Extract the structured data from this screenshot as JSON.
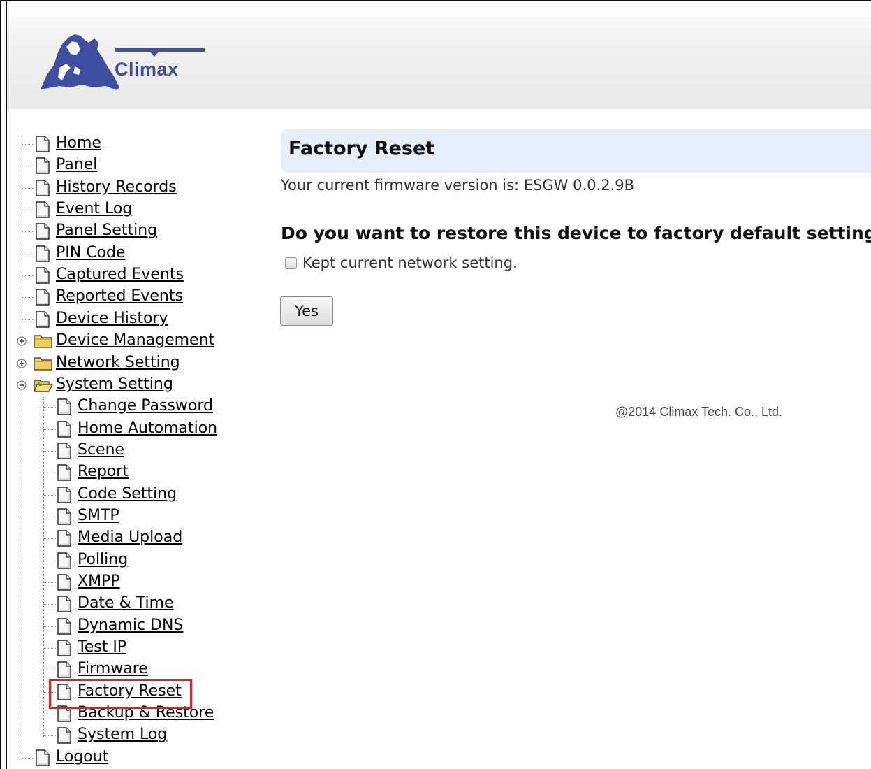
{
  "brand": {
    "name": "Climax",
    "primary_color": "#3e4ea0"
  },
  "nav": {
    "items": [
      {
        "label": "Home",
        "icon": "document-icon"
      },
      {
        "label": "Panel",
        "icon": "document-icon"
      },
      {
        "label": "History Records",
        "icon": "document-icon"
      },
      {
        "label": "Event Log",
        "icon": "document-icon"
      },
      {
        "label": "Panel Setting",
        "icon": "document-icon"
      },
      {
        "label": "PIN Code",
        "icon": "document-icon"
      },
      {
        "label": "Captured Events",
        "icon": "document-icon"
      },
      {
        "label": "Reported Events",
        "icon": "document-icon"
      },
      {
        "label": "Device History",
        "icon": "document-icon"
      },
      {
        "label": "Device Management",
        "icon": "folder-icon",
        "expandable": true,
        "expanded": false
      },
      {
        "label": "Network Setting",
        "icon": "folder-icon",
        "expandable": true,
        "expanded": false
      },
      {
        "label": "System Setting",
        "icon": "folder-open-icon",
        "expandable": true,
        "expanded": true
      }
    ],
    "system_children": [
      {
        "label": "Change Password"
      },
      {
        "label": "Home Automation"
      },
      {
        "label": "Scene"
      },
      {
        "label": "Report"
      },
      {
        "label": "Code Setting"
      },
      {
        "label": "SMTP"
      },
      {
        "label": "Media Upload"
      },
      {
        "label": "Polling"
      },
      {
        "label": "XMPP"
      },
      {
        "label": "Date & Time"
      },
      {
        "label": "Dynamic DNS"
      },
      {
        "label": "Test IP"
      },
      {
        "label": "Firmware"
      },
      {
        "label": "Factory Reset",
        "highlighted": true
      },
      {
        "label": "Backup & Restore"
      },
      {
        "label": "System Log"
      }
    ],
    "logout": {
      "label": "Logout"
    }
  },
  "content": {
    "title": "Factory Reset",
    "firmware_text": "Your current firmware version is: ESGW 0.0.2.9B",
    "question": "Do you want to restore this device to factory default setting?",
    "keep_network_label": "Kept current network setting.",
    "keep_network_checked": false,
    "yes_button": "Yes"
  },
  "footer": {
    "copyright": "@2014 Climax Tech. Co., Ltd."
  },
  "colors": {
    "title_bar": "#e6eefa",
    "highlight": "#e02020"
  }
}
